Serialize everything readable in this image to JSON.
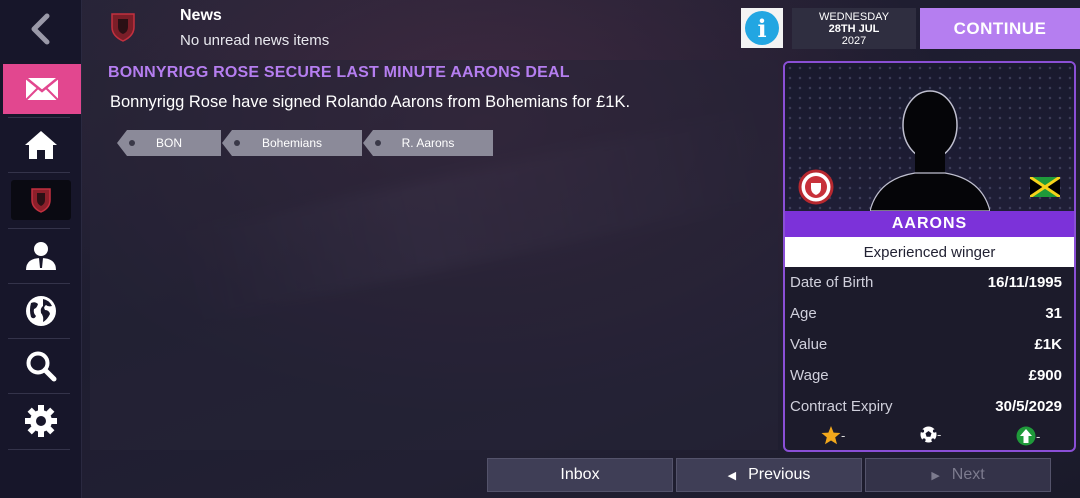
{
  "header": {
    "section_title": "News",
    "section_subtitle": "No unread news items",
    "date": {
      "weekday": "WEDNESDAY",
      "day_month": "28TH JUL",
      "year": "2027"
    },
    "continue_label": "CONTINUE",
    "info_label": "i"
  },
  "sidebar": {
    "items": [
      {
        "icon": "back-arrow-icon"
      },
      {
        "icon": "mail-icon",
        "active": true
      },
      {
        "icon": "home-icon"
      },
      {
        "icon": "club-crest-icon"
      },
      {
        "icon": "staff-icon"
      },
      {
        "icon": "globe-icon"
      },
      {
        "icon": "search-icon"
      },
      {
        "icon": "gear-icon"
      }
    ]
  },
  "article": {
    "headline": "BONNYRIGG ROSE SECURE LAST MINUTE AARONS DEAL",
    "body": "Bonnyrigg Rose have signed Rolando Aarons from Bohemians for £1K.",
    "tags": [
      "BON",
      "Bohemians",
      "R. Aarons"
    ]
  },
  "player": {
    "name": "AARONS",
    "description": "Experienced winger",
    "details": [
      {
        "label": "Date of Birth",
        "value": "16/11/1995"
      },
      {
        "label": "Age",
        "value": "31"
      },
      {
        "label": "Value",
        "value": "£1K"
      },
      {
        "label": "Wage",
        "value": "£900"
      },
      {
        "label": "Contract Expiry",
        "value": "30/5/2029"
      }
    ],
    "attributes": [
      {
        "icon": "star-icon",
        "value": "-"
      },
      {
        "icon": "football-icon",
        "value": "-"
      },
      {
        "icon": "growth-arrow-icon",
        "value": "-"
      }
    ],
    "nationality_flag": "jamaica-flag-icon"
  },
  "footer": {
    "inbox_label": "Inbox",
    "previous_label": "Previous",
    "next_label": "Next"
  },
  "colors": {
    "accent_purple": "#b57ef0",
    "name_bar": "#7c32d9",
    "active_tab": "#e2478f",
    "info_blue": "#22a6e2"
  }
}
